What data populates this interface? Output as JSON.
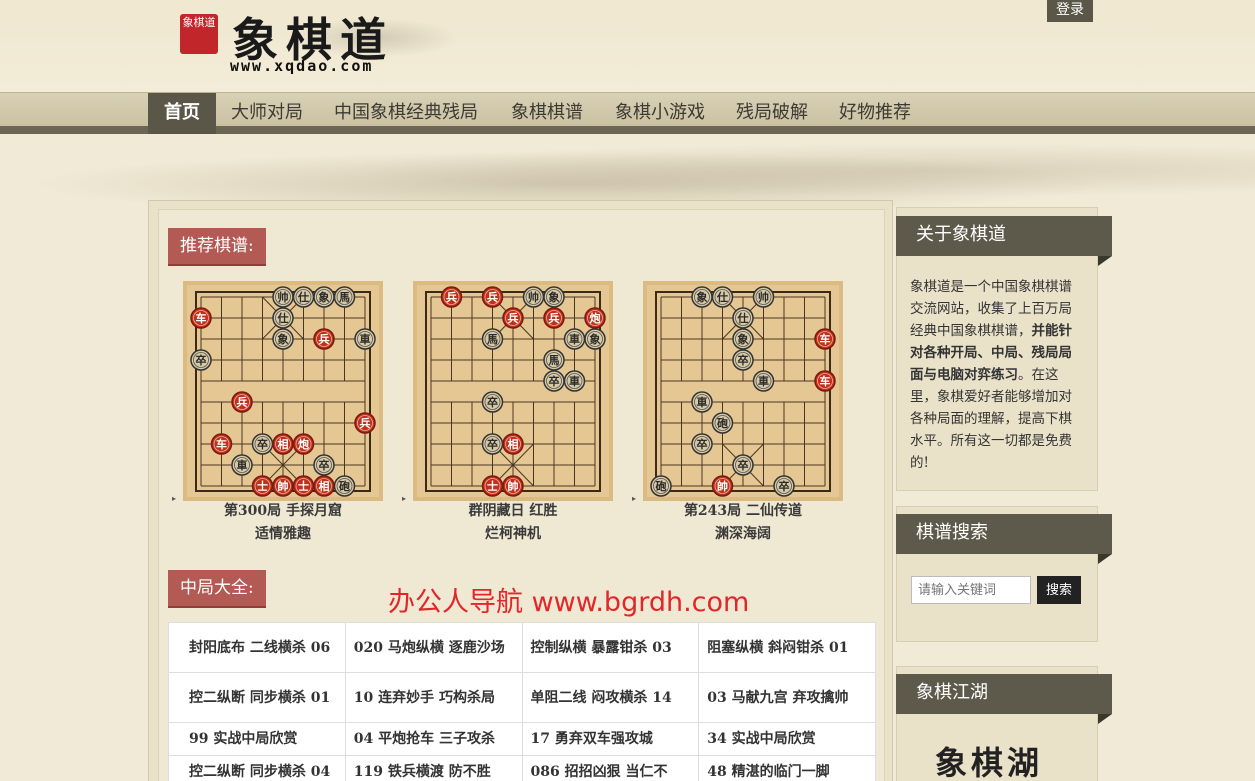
{
  "header": {
    "seal_text": "象棋道",
    "logo_title": "象棋道",
    "logo_url": "www.xqdao.com",
    "login_label": "登录"
  },
  "nav": {
    "items": [
      {
        "label": "首页",
        "active": true
      },
      {
        "label": "大师对局"
      },
      {
        "label": "中国象棋经典残局"
      },
      {
        "label": "象棋棋谱"
      },
      {
        "label": "象棋小游戏"
      },
      {
        "label": "残局破解"
      },
      {
        "label": "好物推荐"
      }
    ]
  },
  "recommended": {
    "title": "推荐棋谱:",
    "items": [
      {
        "line1": "第300局  手探月窟",
        "line2": "适情雅趣"
      },
      {
        "line1": "群阴藏日  红胜",
        "line2": "烂柯神机"
      },
      {
        "line1": "第243局  二仙传道",
        "line2": "渊深海阔"
      }
    ]
  },
  "midgame": {
    "title": "中局大全:",
    "rows": [
      [
        "封阳底布  二线横杀  06",
        "020  马炮纵横  逐鹿沙场",
        "控制纵横  暴露钳杀  03",
        "阻塞纵横  斜闷钳杀 01"
      ],
      [
        "控二纵断  同步横杀  01",
        "10  连弃妙手  巧构杀局",
        "单阻二线  闷攻横杀  14",
        "03  马献九宫  弃攻擒帅"
      ],
      [
        "99  实战中局欣赏",
        "04  平炮抢车  三子攻杀",
        "17  勇弃双车强攻城",
        "34  实战中局欣赏"
      ],
      [
        "控二纵断  同步横杀 04",
        "119  铁兵横渡  防不胜",
        "086  招招凶狠  当仁不",
        "48  精湛的临门一脚"
      ]
    ]
  },
  "watermark": "办公人导航 www.bgrdh.com",
  "sidebar": {
    "about": {
      "title": "关于象棋道",
      "text_a": "象棋道是一个中国象棋棋谱交流网站，收集了上百万局经典中国象棋棋谱，",
      "text_b": "并能针对各种开局、中局、残局局面与电脑对弈练习",
      "text_c": "。在这里，象棋爱好者能够增加对各种局面的理解，提高下棋水平。所有这一切都是免费的!"
    },
    "search": {
      "title": "棋谱搜索",
      "placeholder": "请输入关键词",
      "button": "搜索"
    },
    "jianghu": {
      "title": "象棋江湖",
      "logo_text": "象棋湖"
    }
  },
  "colors": {
    "nav_active": "#5a5648",
    "section_title_bg": "#b45a55",
    "board_bg": "#e5c793",
    "red_piece": "#c0301e",
    "black_piece": "#2a2a2a",
    "watermark": "#e3262a"
  },
  "boards": [
    {
      "pieces": [
        {
          "c": "b",
          "t": "帅",
          "x": 4,
          "y": 0
        },
        {
          "c": "b",
          "t": "仕",
          "x": 5,
          "y": 0
        },
        {
          "c": "b",
          "t": "象",
          "x": 6,
          "y": 0
        },
        {
          "c": "b",
          "t": "馬",
          "x": 7,
          "y": 0
        },
        {
          "c": "r",
          "t": "车",
          "x": 0,
          "y": 1
        },
        {
          "c": "b",
          "t": "仕",
          "x": 4,
          "y": 1
        },
        {
          "c": "b",
          "t": "象",
          "x": 4,
          "y": 2
        },
        {
          "c": "r",
          "t": "兵",
          "x": 6,
          "y": 2
        },
        {
          "c": "b",
          "t": "車",
          "x": 8,
          "y": 2
        },
        {
          "c": "b",
          "t": "卒",
          "x": 0,
          "y": 3
        },
        {
          "c": "r",
          "t": "兵",
          "x": 2,
          "y": 5
        },
        {
          "c": "r",
          "t": "兵",
          "x": 8,
          "y": 6
        },
        {
          "c": "r",
          "t": "车",
          "x": 1,
          "y": 7
        },
        {
          "c": "b",
          "t": "卒",
          "x": 3,
          "y": 7
        },
        {
          "c": "r",
          "t": "相",
          "x": 4,
          "y": 7
        },
        {
          "c": "r",
          "t": "炮",
          "x": 5,
          "y": 7
        },
        {
          "c": "b",
          "t": "車",
          "x": 2,
          "y": 8
        },
        {
          "c": "b",
          "t": "卒",
          "x": 6,
          "y": 8
        },
        {
          "c": "r",
          "t": "士",
          "x": 3,
          "y": 9
        },
        {
          "c": "r",
          "t": "帥",
          "x": 4,
          "y": 9
        },
        {
          "c": "r",
          "t": "士",
          "x": 5,
          "y": 9
        },
        {
          "c": "r",
          "t": "相",
          "x": 6,
          "y": 9
        },
        {
          "c": "b",
          "t": "砲",
          "x": 7,
          "y": 9
        }
      ]
    },
    {
      "pieces": [
        {
          "c": "r",
          "t": "兵",
          "x": 1,
          "y": 0
        },
        {
          "c": "r",
          "t": "兵",
          "x": 3,
          "y": 0
        },
        {
          "c": "b",
          "t": "帅",
          "x": 5,
          "y": 0
        },
        {
          "c": "b",
          "t": "象",
          "x": 6,
          "y": 0
        },
        {
          "c": "r",
          "t": "兵",
          "x": 4,
          "y": 1
        },
        {
          "c": "r",
          "t": "兵",
          "x": 6,
          "y": 1
        },
        {
          "c": "r",
          "t": "炮",
          "x": 8,
          "y": 1
        },
        {
          "c": "b",
          "t": "馬",
          "x": 3,
          "y": 2
        },
        {
          "c": "b",
          "t": "車",
          "x": 7,
          "y": 2
        },
        {
          "c": "b",
          "t": "象",
          "x": 8,
          "y": 2
        },
        {
          "c": "b",
          "t": "馬",
          "x": 6,
          "y": 3
        },
        {
          "c": "b",
          "t": "卒",
          "x": 6,
          "y": 4
        },
        {
          "c": "b",
          "t": "車",
          "x": 7,
          "y": 4
        },
        {
          "c": "b",
          "t": "卒",
          "x": 3,
          "y": 5
        },
        {
          "c": "b",
          "t": "卒",
          "x": 3,
          "y": 7
        },
        {
          "c": "r",
          "t": "相",
          "x": 4,
          "y": 7
        },
        {
          "c": "r",
          "t": "士",
          "x": 3,
          "y": 9
        },
        {
          "c": "r",
          "t": "帥",
          "x": 4,
          "y": 9
        }
      ]
    },
    {
      "pieces": [
        {
          "c": "b",
          "t": "象",
          "x": 2,
          "y": 0
        },
        {
          "c": "b",
          "t": "仕",
          "x": 3,
          "y": 0
        },
        {
          "c": "b",
          "t": "帅",
          "x": 5,
          "y": 0
        },
        {
          "c": "b",
          "t": "仕",
          "x": 4,
          "y": 1
        },
        {
          "c": "b",
          "t": "象",
          "x": 4,
          "y": 2
        },
        {
          "c": "r",
          "t": "车",
          "x": 8,
          "y": 2
        },
        {
          "c": "b",
          "t": "卒",
          "x": 4,
          "y": 3
        },
        {
          "c": "b",
          "t": "車",
          "x": 5,
          "y": 4
        },
        {
          "c": "r",
          "t": "车",
          "x": 8,
          "y": 4
        },
        {
          "c": "b",
          "t": "車",
          "x": 2,
          "y": 5
        },
        {
          "c": "b",
          "t": "砲",
          "x": 3,
          "y": 6
        },
        {
          "c": "b",
          "t": "卒",
          "x": 2,
          "y": 7
        },
        {
          "c": "b",
          "t": "卒",
          "x": 4,
          "y": 8
        },
        {
          "c": "b",
          "t": "砲",
          "x": 0,
          "y": 9
        },
        {
          "c": "r",
          "t": "帥",
          "x": 3,
          "y": 9
        },
        {
          "c": "b",
          "t": "卒",
          "x": 6,
          "y": 9
        }
      ]
    }
  ]
}
